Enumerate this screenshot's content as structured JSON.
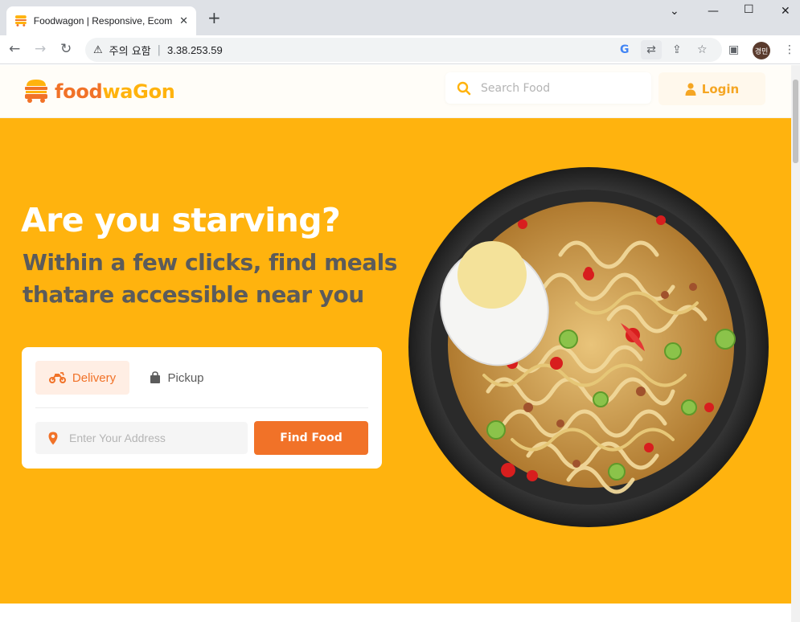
{
  "browser": {
    "tab_title": "Foodwagon | Responsive, Ecomm",
    "tab_close": "✕",
    "new_tab": "+",
    "security_label": "주의 요함",
    "url": "3.38.253.59",
    "profile_initials": "경민"
  },
  "header": {
    "logo_text_part1": "food",
    "logo_text_part2": "waGon",
    "search_placeholder": "Search Food",
    "login_label": "Login"
  },
  "hero": {
    "headline": "Are you starving?",
    "subheadline": "Within a few clicks, find meals thatare accessible near you"
  },
  "order_card": {
    "tabs": [
      {
        "label": "Delivery",
        "icon": "motorbike-icon",
        "active": true
      },
      {
        "label": "Pickup",
        "icon": "shopping-bag-icon",
        "active": false
      }
    ],
    "address_placeholder": "Enter Your Address",
    "find_button": "Find Food"
  },
  "colors": {
    "hero_bg": "#ffb30e",
    "accent_orange": "#f17228",
    "logo_orange": "#f17228",
    "logo_yellow": "#ffb30e",
    "login_text": "#f5a623"
  }
}
